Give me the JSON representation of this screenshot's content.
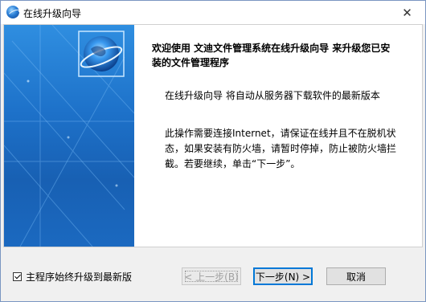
{
  "window": {
    "title": "在线升级向导",
    "close_glyph": "✕"
  },
  "content": {
    "heading": "欢迎使用 文迪文件管理系统在线升级向导 来升级您已安装的文件管理程序",
    "paragraph1": "在线升级向导 将自动从服务器下载软件的最新版本",
    "paragraph2": "此操作需要连接Internet，请保证在线并且不在脱机状态，如果安装有防火墙，请暂时停掉，防止被防火墙拦截。若要继续，单击“下一步”。"
  },
  "footer": {
    "checkbox_label": "主程序始终升级到最新版",
    "checkbox_checked": true,
    "back_label": "< 上一步(B)",
    "next_label": "下一步(N) >",
    "cancel_label": "取消"
  },
  "icons": {
    "app": "globe-icon",
    "side_logo": "globe-logo-icon"
  },
  "colors": {
    "side_panel": "#1d71c9",
    "accent": "#0078d7"
  }
}
